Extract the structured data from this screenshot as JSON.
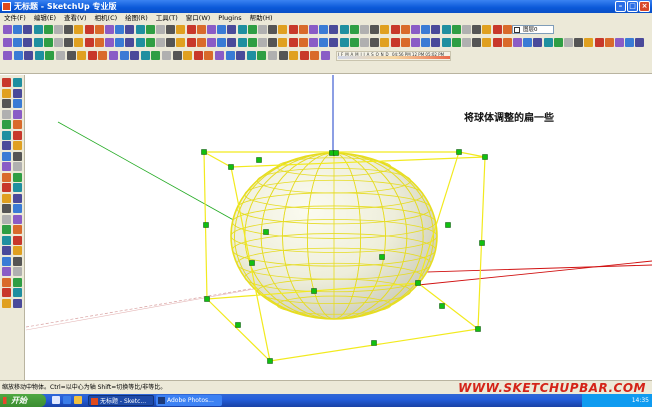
{
  "window": {
    "title": "无标题 - SketchUp 专业版",
    "controls": [
      "minimize",
      "maximize",
      "close"
    ]
  },
  "menu": [
    "文件(F)",
    "编辑(E)",
    "查看(V)",
    "相机(C)",
    "绘图(R)",
    "工具(T)",
    "窗口(W)",
    "Plugins",
    "帮助(H)"
  ],
  "toolbar": {
    "layer_value": "图层0",
    "shadow_months": "J F M A M J J A S O N D",
    "shadow_times": "04:56 PM  12 PM  05:02 PM"
  },
  "viewport": {
    "annotation": "将球体调整的扁一些",
    "selected_object": "flattened-sphere"
  },
  "status": {
    "hint": "缩放移动中物体。Ctrl=以中心为轴 Shift=切换等比/非等比。",
    "watermark": "WWW.SKETCHUPBAR.COM"
  },
  "taskbar": {
    "start_label": "开始",
    "items": [
      "无标题 - Sketc...",
      "Adobe Photos..."
    ],
    "clock": "14:35"
  },
  "colors": {
    "axis_red": "#d01010",
    "axis_green": "#22aa22",
    "axis_blue": "#1a3cc8",
    "selection": "#f2ea1e",
    "grip": "#10c010",
    "sphere_face": "#efefdc",
    "watermark": "#d42318"
  }
}
